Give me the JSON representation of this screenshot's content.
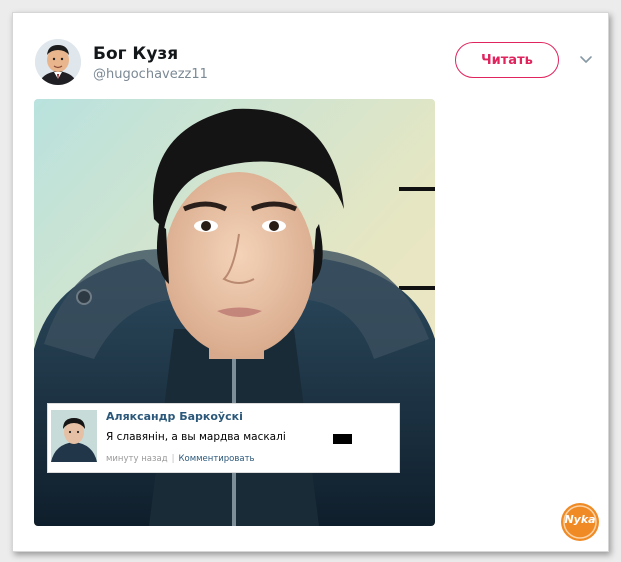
{
  "tweet": {
    "display_name": "Бог Кузя",
    "handle": "@hugochavezz11",
    "follow_label": "Читать"
  },
  "comment": {
    "author": "Аляксандр Баркоўскі",
    "text": "Я славянін, а вы мардва маскалі",
    "time": "минуту назад",
    "reply_label": "Комментировать"
  },
  "watermark": {
    "text": "Nyka"
  },
  "colors": {
    "follow_accent": "#e0245e",
    "comment_author": "#2b587a",
    "watermark_orange": "#f08a24"
  }
}
